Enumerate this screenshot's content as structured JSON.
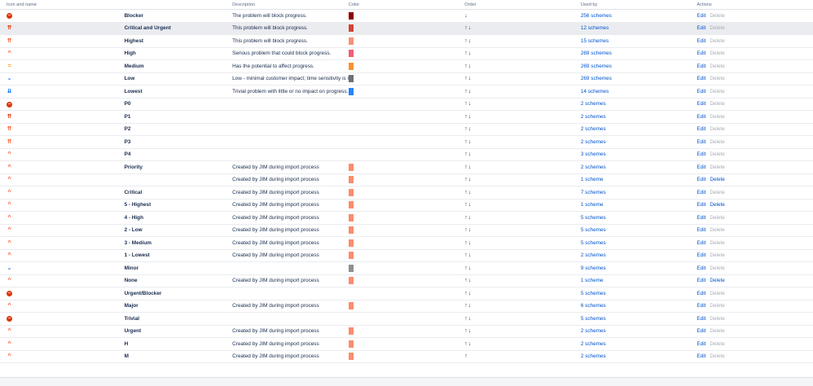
{
  "headers": {
    "icon_name": "Icon and name",
    "description": "Description",
    "color": "Color",
    "order": "Order",
    "used_by": "Used by",
    "actions": "Actions"
  },
  "actions": {
    "edit": "Edit",
    "delete": "Delete"
  },
  "rows": [
    {
      "icon": "blocker-icon",
      "name": "Blocker",
      "description": "The problem will block progress.",
      "color": "#8b0000",
      "order": "↓",
      "used_by": "256 schemes",
      "delete_enabled": false
    },
    {
      "icon": "critical-icon",
      "name": "Critical and Urgent",
      "description": "This problem will block progress.",
      "color": "#d04437",
      "order": "↑↓",
      "used_by": "12 schemes",
      "delete_enabled": false
    },
    {
      "icon": "highest-icon",
      "name": "Highest",
      "description": "This problem will block progress.",
      "color": "#f79277",
      "order": "↑↓",
      "used_by": "15 schemes",
      "delete_enabled": false
    },
    {
      "icon": "high-icon",
      "name": "High",
      "description": "Serious problem that could block progress.",
      "color": "#f15c75",
      "order": "↑↓",
      "used_by": "269 schemes",
      "delete_enabled": false
    },
    {
      "icon": "medium-icon",
      "name": "Medium",
      "description": "Has the potential to affect progress.",
      "color": "#f79232",
      "order": "↑↓",
      "used_by": "269 schemes",
      "delete_enabled": false
    },
    {
      "icon": "low-icon",
      "name": "Low",
      "description": "Low - minimal customer impact; time sensitivity is low. Ex: back end change, accessory mappings",
      "color": "#707070",
      "order": "↑↓",
      "used_by": "269 schemes",
      "delete_enabled": false
    },
    {
      "icon": "lowest-icon",
      "name": "Lowest",
      "description": "Trivial problem with little or no impact on progress.",
      "color": "#2684ff",
      "order": "↑↓",
      "used_by": "14 schemes",
      "delete_enabled": false
    },
    {
      "icon": "blocker-icon",
      "name": "P0",
      "description": "",
      "color": "",
      "order": "↑↓",
      "used_by": "2 schemes",
      "delete_enabled": false
    },
    {
      "icon": "critical-icon",
      "name": "P1",
      "description": "",
      "color": "",
      "order": "↑↓",
      "used_by": "2 schemes",
      "delete_enabled": false
    },
    {
      "icon": "highest-icon",
      "name": "P2",
      "description": "",
      "color": "",
      "order": "↑↓",
      "used_by": "2 schemes",
      "delete_enabled": false
    },
    {
      "icon": "highest-icon",
      "name": "P3",
      "description": "",
      "color": "",
      "order": "↑↓",
      "used_by": "2 schemes",
      "delete_enabled": false
    },
    {
      "icon": "high-icon",
      "name": "P4",
      "description": "",
      "color": "",
      "order": "↑↓",
      "used_by": "3 schemes",
      "delete_enabled": false
    },
    {
      "icon": "high-icon",
      "name": "Priority",
      "description": "Created by JIM during import process",
      "color": "#fa8c6e",
      "order": "↑↓",
      "used_by": "2 schemes",
      "delete_enabled": false
    },
    {
      "icon": "high-icon",
      "name": "",
      "description": "Created by JIM during import process",
      "color": "#fa8c6e",
      "order": "↑↓",
      "used_by": "1 scheme",
      "delete_enabled": true
    },
    {
      "icon": "high-icon",
      "name": "Critical",
      "description": "Created by JIM during import process",
      "color": "#fa8c6e",
      "order": "↑↓",
      "used_by": "7 schemes",
      "delete_enabled": false
    },
    {
      "icon": "high-icon",
      "name": "5 - Highest",
      "description": "Created by JIM during import process",
      "color": "#fa8c6e",
      "order": "↑↓",
      "used_by": "1 scheme",
      "delete_enabled": true
    },
    {
      "icon": "high-icon",
      "name": "4 - High",
      "description": "Created by JIM during import process",
      "color": "#fa8c6e",
      "order": "↑↓",
      "used_by": "5 schemes",
      "delete_enabled": false
    },
    {
      "icon": "high-icon",
      "name": "2 - Low",
      "description": "Created by JIM during import process",
      "color": "#fa8c6e",
      "order": "↑↓",
      "used_by": "5 schemes",
      "delete_enabled": false
    },
    {
      "icon": "high-icon",
      "name": "3 - Medium",
      "description": "Created by JIM during import process",
      "color": "#fa8c6e",
      "order": "↑↓",
      "used_by": "5 schemes",
      "delete_enabled": false
    },
    {
      "icon": "high-icon",
      "name": "1 - Lowest",
      "description": "Created by JIM during import process",
      "color": "#fa8c6e",
      "order": "↑↓",
      "used_by": "2 schemes",
      "delete_enabled": false
    },
    {
      "icon": "low-icon",
      "name": "Minor",
      "description": "",
      "color": "#8f8f8f",
      "order": "↑↓",
      "used_by": "9 schemes",
      "delete_enabled": false
    },
    {
      "icon": "high-icon",
      "name": "None",
      "description": "Created by JIM during import process",
      "color": "#fa8c6e",
      "order": "↑↓",
      "used_by": "1 scheme",
      "delete_enabled": true
    },
    {
      "icon": "blocker-icon",
      "name": "Urgent/Blocker",
      "description": "",
      "color": "",
      "order": "↑↓",
      "used_by": "5 schemes",
      "delete_enabled": false
    },
    {
      "icon": "high-icon",
      "name": "Major",
      "description": "Created by JIM during import process",
      "color": "#fa8c6e",
      "order": "↑↓",
      "used_by": "6 schemes",
      "delete_enabled": false
    },
    {
      "icon": "blocker-icon",
      "name": "Trivial",
      "description": "",
      "color": "",
      "order": "↑↓",
      "used_by": "5 schemes",
      "delete_enabled": false
    },
    {
      "icon": "high-icon",
      "name": "Urgent",
      "description": "Created by JIM during import process",
      "color": "#fa8c6e",
      "order": "↑↓",
      "used_by": "2 schemes",
      "delete_enabled": false
    },
    {
      "icon": "high-icon",
      "name": "H",
      "description": "Created by JIM during import process",
      "color": "#fa8c6e",
      "order": "↑↓",
      "used_by": "2 schemes",
      "delete_enabled": false
    },
    {
      "icon": "high-icon",
      "name": "M",
      "description": "Created by JIM during import process",
      "color": "#fa8c6e",
      "order": "↑",
      "used_by": "2 schemes",
      "delete_enabled": false
    }
  ]
}
